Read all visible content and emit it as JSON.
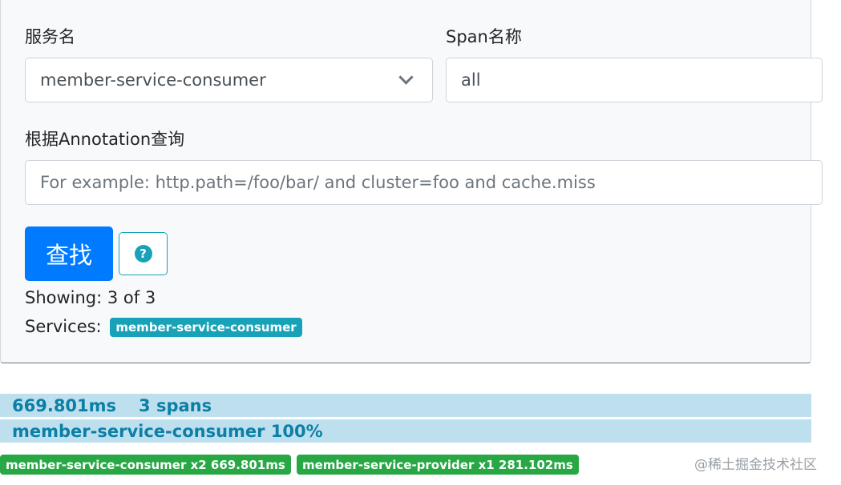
{
  "form": {
    "service_label": "服务名",
    "service_value": "member-service-consumer",
    "span_label": "Span名称",
    "span_value": "all",
    "annotation_label": "根据Annotation查询",
    "annotation_placeholder": "For example: http.path=/foo/bar/ and cluster=foo and cache.miss",
    "search_button": "查找",
    "help_icon_glyph": "?",
    "help_icon": "question-circle-icon"
  },
  "summary": {
    "showing": "Showing: 3 of 3",
    "services_label": "Services:",
    "services_badge": "member-service-consumer"
  },
  "result": {
    "duration": "669.801ms",
    "spans": "3 spans",
    "service_bar": "member-service-consumer 100%",
    "service_badges": [
      "member-service-consumer x2 669.801ms",
      "member-service-provider x1 281.102ms"
    ]
  },
  "watermark": "@稀土掘金技术社区",
  "colors": {
    "primary": "#007bff",
    "info": "#17a2b8",
    "success": "#28a745",
    "bar_bg": "#bee0ee",
    "bar_text": "#0c7fa6"
  }
}
